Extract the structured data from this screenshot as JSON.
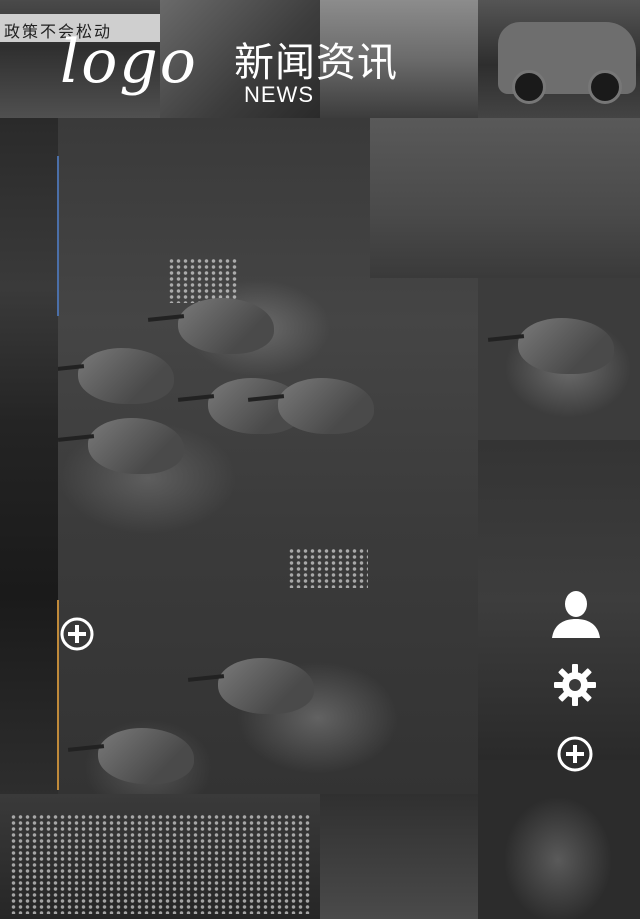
{
  "header": {
    "logo_text": "logo",
    "title_cn": "新闻资讯",
    "title_en": "NEWS",
    "banner_text": "政策不会松动"
  },
  "actions": {
    "add_left_icon": "plus-circle-icon",
    "user_icon": "user-icon",
    "settings_icon": "gear-icon",
    "add_right_icon": "plus-circle-icon"
  },
  "colors": {
    "background": "#1e1e1e",
    "accent_blue": "#4b6fa8",
    "accent_orange": "#c08a3a",
    "icon": "#ffffff"
  }
}
